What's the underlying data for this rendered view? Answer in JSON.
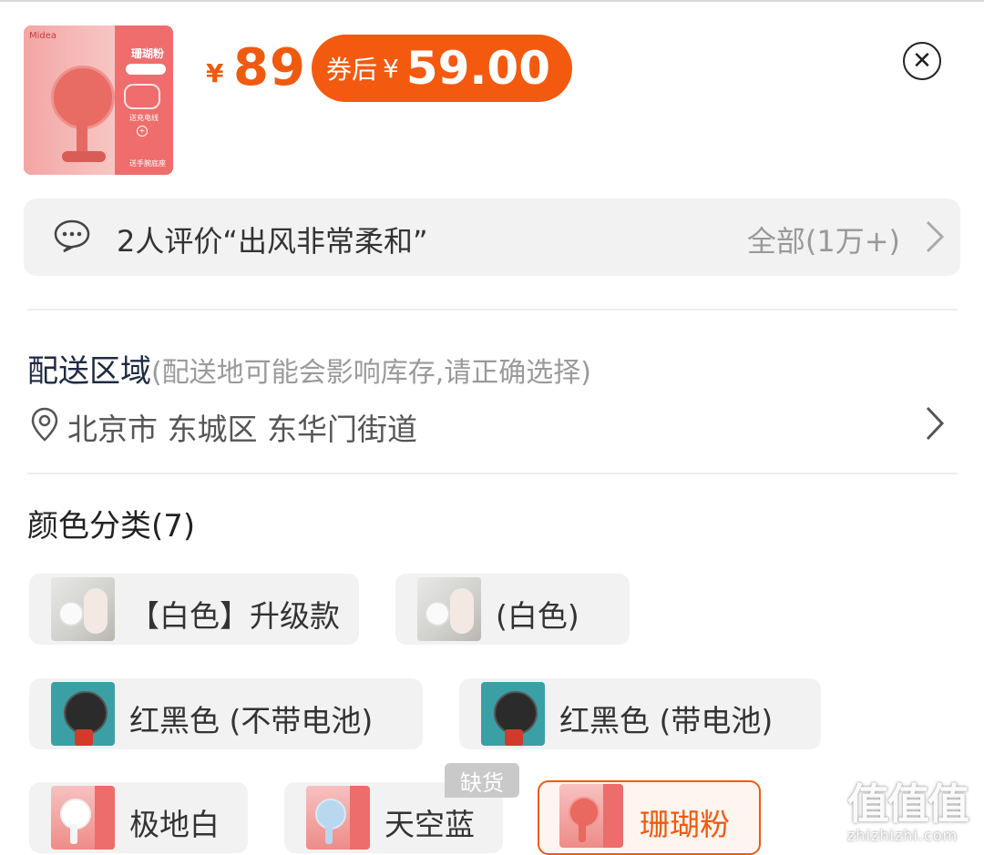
{
  "product": {
    "thumb": {
      "brand": "Midea",
      "band_title": "珊瑚粉",
      "band_line1": "送充电线",
      "band_line2": "送手腕底座"
    },
    "price_symbol": "¥",
    "price": "89",
    "coupon_label": "券后",
    "coupon_symbol": "¥",
    "coupon_price": "59.00",
    "close_icon": "close-icon",
    "accent_color": "#f35a10"
  },
  "review": {
    "text": "2人评价“出风非常柔和”",
    "all_label": "全部(1万+)"
  },
  "delivery": {
    "title": "配送区域",
    "hint": "(配送地可能会影响库存,请正确选择)",
    "address": "北京市 东城区 东华门街道"
  },
  "colors": {
    "title": "颜色分类(7)",
    "options": [
      {
        "label": "【白色】升级款",
        "image": "white-upgrade"
      },
      {
        "label": "(白色)",
        "image": "white"
      },
      {
        "label": "红黑色 (不带电池)",
        "image": "redblack-no-battery"
      },
      {
        "label": "红黑色 (带电池)",
        "image": "redblack-battery"
      },
      {
        "label": "极地白",
        "image": "polar-white"
      },
      {
        "label": "天空蓝",
        "image": "sky-blue",
        "tag": "缺货"
      },
      {
        "label": "珊瑚粉",
        "image": "coral-pink",
        "selected": true
      }
    ]
  },
  "watermark": {
    "logo": "值值值",
    "url": "zhizhizhi.com"
  }
}
